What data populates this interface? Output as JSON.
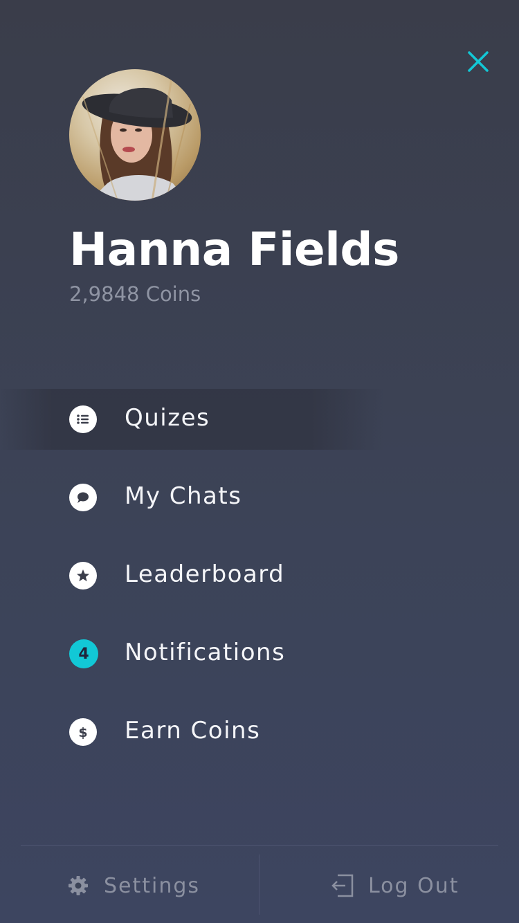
{
  "profile": {
    "name": "Hanna Fields",
    "coins": "2,9848 Coins"
  },
  "menu": {
    "items": [
      {
        "label": "Quizes",
        "icon": "list-icon",
        "active": true
      },
      {
        "label": "My Chats",
        "icon": "chat-bubble-icon"
      },
      {
        "label": "Leaderboard",
        "icon": "star-icon"
      },
      {
        "label": "Notifications",
        "icon": "notification-badge",
        "badge": "4"
      },
      {
        "label": "Earn Coins",
        "icon": "dollar-icon"
      }
    ]
  },
  "footer": {
    "settings_label": "Settings",
    "logout_label": "Log Out"
  },
  "colors": {
    "accent": "#12c8d6",
    "background_top": "#3a3d4a",
    "background_bottom": "#3d4560",
    "muted_text": "#8f94a3"
  }
}
